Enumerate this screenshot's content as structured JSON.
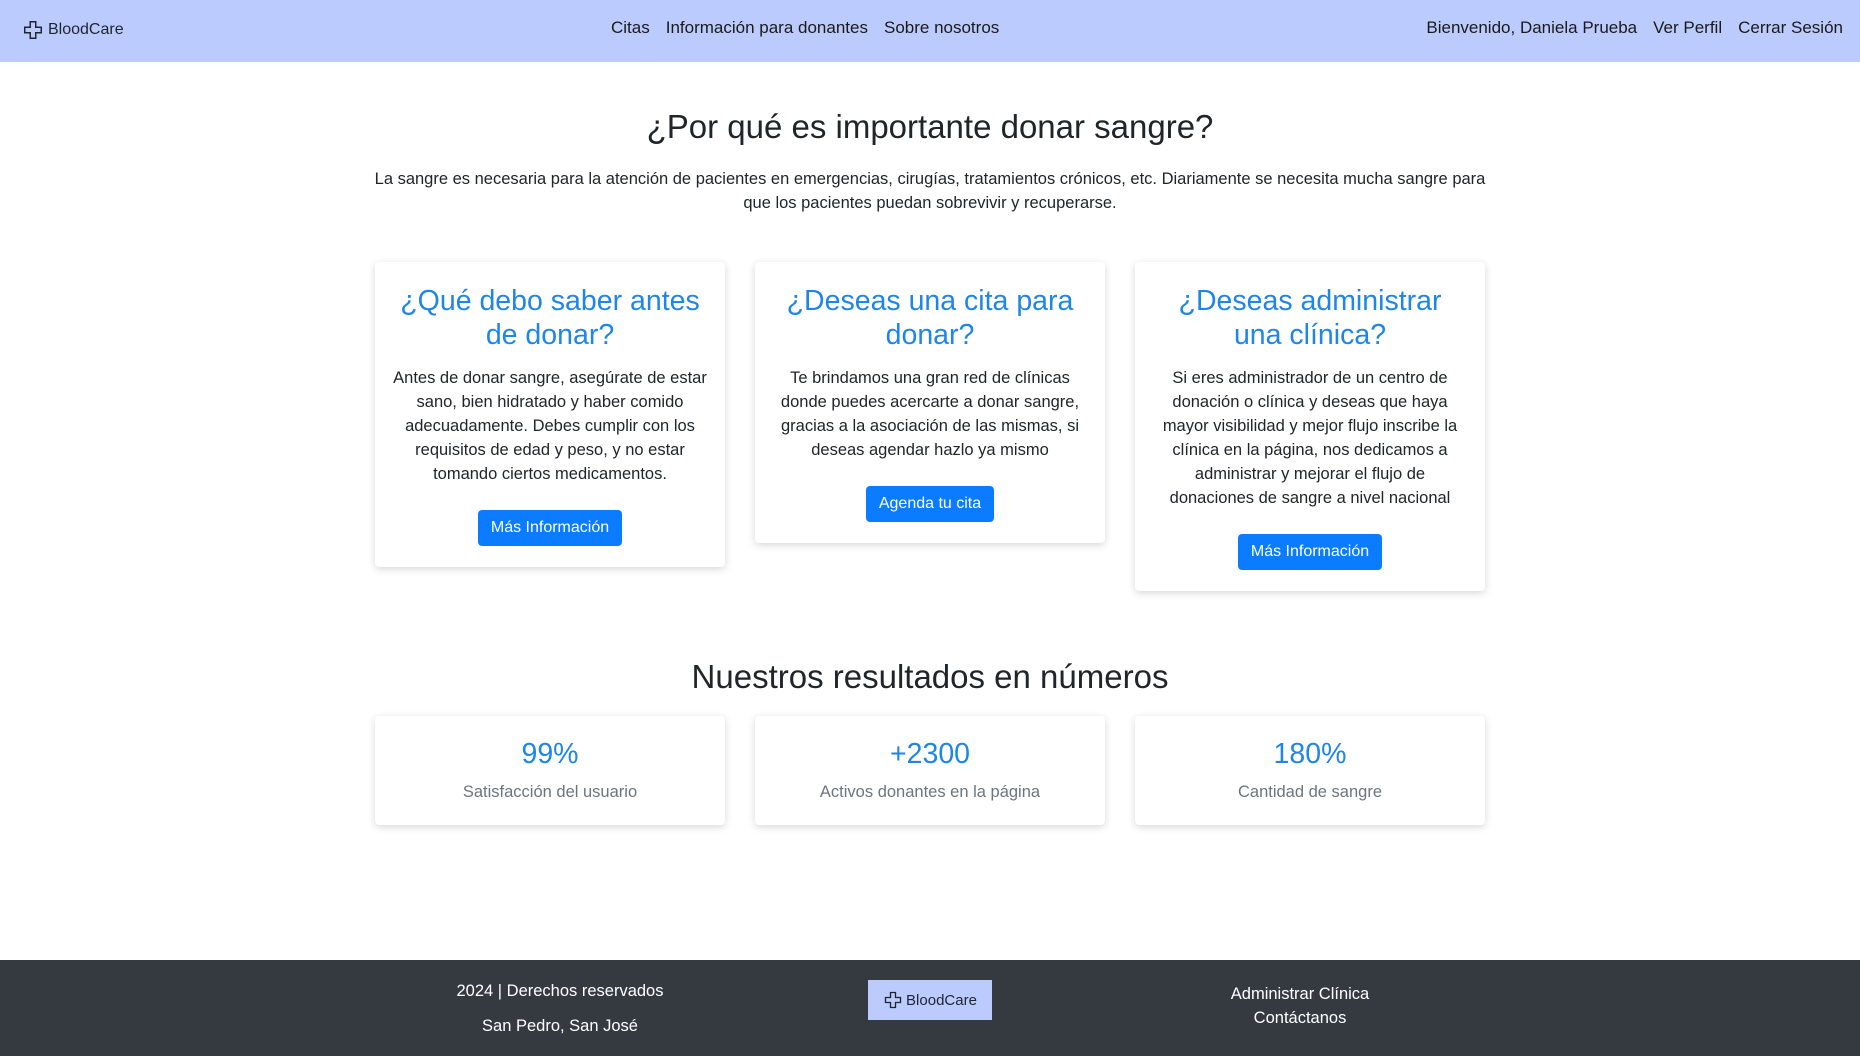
{
  "header": {
    "brand": "BloodCare",
    "nav": [
      "Citas",
      "Información para donantes",
      "Sobre nosotros"
    ],
    "welcome": "Bienvenido, Daniela Prueba",
    "profile": "Ver Perfil",
    "logout": "Cerrar Sesión"
  },
  "intro": {
    "title": "¿Por qué es importante donar sangre?",
    "text": "La sangre es necesaria para la atención de pacientes en emergencias, cirugías, tratamientos crónicos, etc. Diariamente se necesita mucha sangre para que los pacientes puedan sobrevivir y recuperarse."
  },
  "cards": [
    {
      "title": "¿Qué debo saber antes de donar?",
      "text": "Antes de donar sangre, asegúrate de estar sano, bien hidratado y haber comido adecuadamente. Debes cumplir con los requisitos de edad y peso, y no estar tomando ciertos medicamentos.",
      "button": "Más Información"
    },
    {
      "title": "¿Deseas una cita para donar?",
      "text": "Te brindamos una gran red de clínicas donde puedes acercarte a donar sangre, gracias a la asociación de las mismas, si deseas agendar hazlo ya mismo",
      "button": "Agenda tu cita"
    },
    {
      "title": "¿Deseas administrar una clínica?",
      "text": "Si eres administrador de un centro de donación o clínica y deseas que haya mayor visibilidad y mejor flujo inscribe la clínica en la página, nos dedicamos a administrar y mejorar el flujo de donaciones de sangre a nivel nacional",
      "button": "Más Información"
    }
  ],
  "stats": {
    "title": "Nuestros resultados en números",
    "items": [
      {
        "value": "99%",
        "label": "Satisfacción del usuario"
      },
      {
        "value": "+2300",
        "label": "Activos donantes en la página"
      },
      {
        "value": "180%",
        "label": "Cantidad de sangre"
      }
    ]
  },
  "footer": {
    "copyright": "2024 | Derechos reservados",
    "location": "San Pedro, San José",
    "brand": "BloodCare",
    "links": [
      "Administrar Clínica",
      "Contáctanos"
    ]
  },
  "colors": {
    "navbar": "#bccbfd",
    "accent": "#1e86e8",
    "button": "#0b7bff",
    "footer": "#343a40"
  }
}
